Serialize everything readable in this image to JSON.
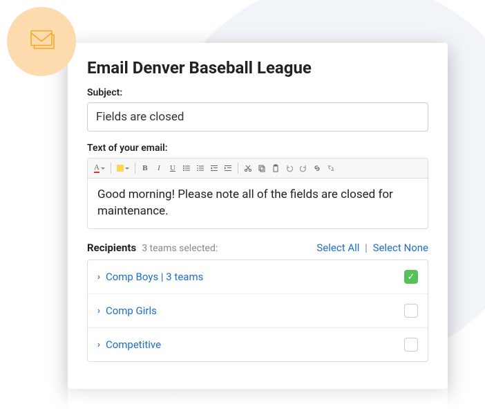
{
  "page": {
    "title": "Email Denver Baseball League"
  },
  "subject": {
    "label": "Subject:",
    "value": "Fields are closed"
  },
  "body": {
    "label": "Text of your email:",
    "value": "Good morning! Please note all of the fields are closed for maintenance."
  },
  "toolbar": {
    "font_color": "A",
    "bg_color": "A",
    "bold": "B",
    "italic": "I",
    "underline": "U"
  },
  "recipients": {
    "title": "Recipients",
    "summary": "3 teams selected:",
    "select_all": "Select All",
    "select_none": "Select None",
    "items": [
      {
        "label": "Comp Boys | 3 teams",
        "checked": true
      },
      {
        "label": "Comp Girls",
        "checked": false
      },
      {
        "label": "Competitive",
        "checked": false
      }
    ]
  }
}
